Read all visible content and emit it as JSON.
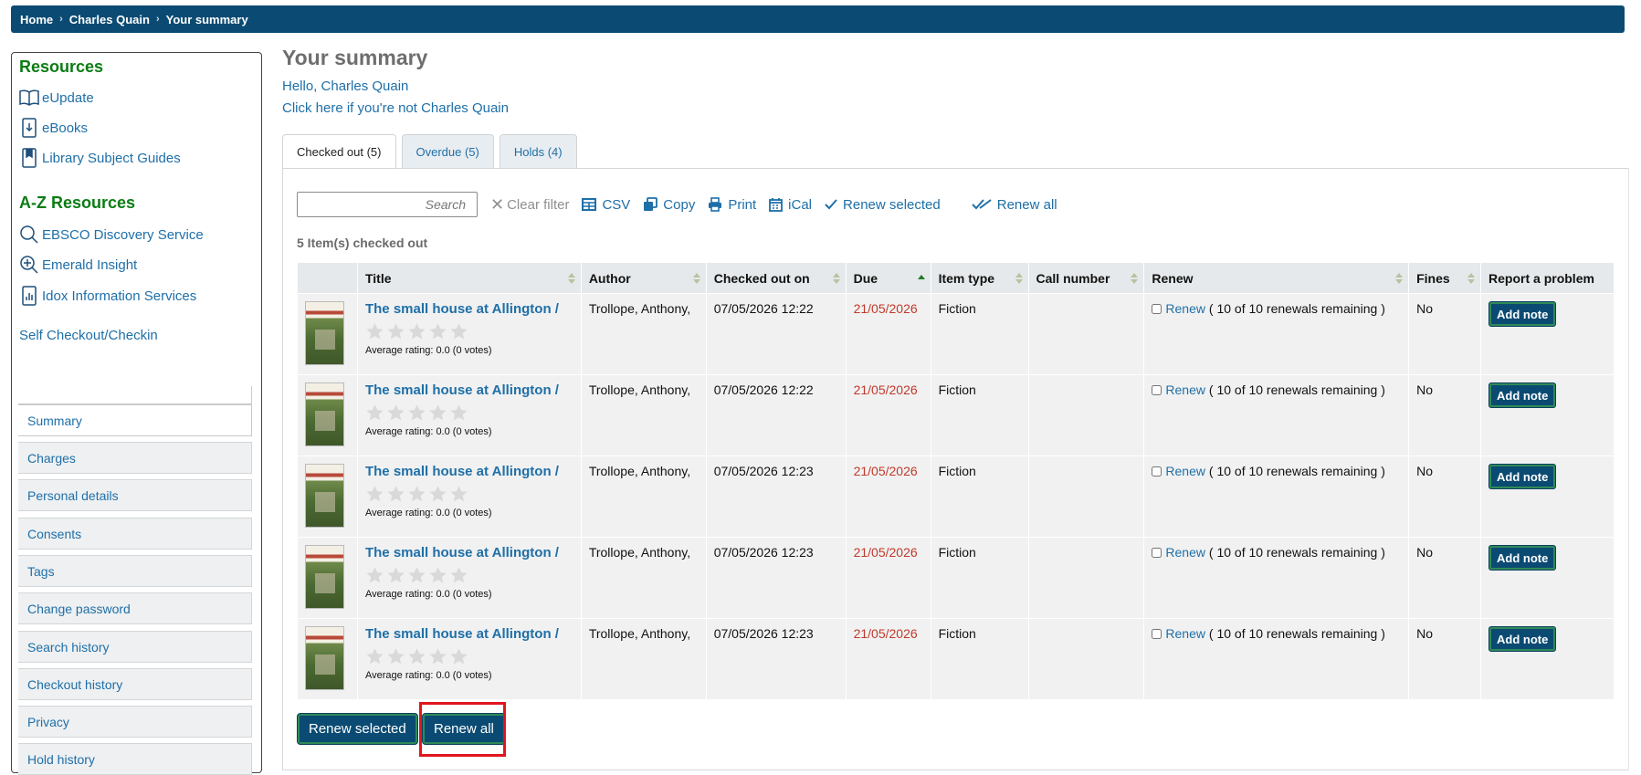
{
  "breadcrumb": [
    "Home",
    "Charles Quain",
    "Your summary"
  ],
  "sidebar": {
    "resources_heading": "Resources",
    "resources": [
      {
        "label": "eUpdate",
        "icon": "book-open-icon"
      },
      {
        "label": "eBooks",
        "icon": "download-file-icon"
      },
      {
        "label": "Library Subject Guides",
        "icon": "bookmark-icon"
      }
    ],
    "az_heading": "A-Z Resources",
    "az_resources": [
      {
        "label": "EBSCO Discovery Service",
        "icon": "search-icon"
      },
      {
        "label": "Emerald Insight",
        "icon": "zoom-in-icon"
      },
      {
        "label": "Idox Information Services",
        "icon": "bar-chart-icon"
      }
    ],
    "self_checkout": "Self Checkout/Checkin",
    "nav": [
      "Summary",
      "Charges",
      "Personal details",
      "Consents",
      "Tags",
      "Change password",
      "Search history",
      "Checkout history",
      "Privacy",
      "Hold history"
    ],
    "active_nav": "Summary"
  },
  "main": {
    "title": "Your summary",
    "hello": "Hello, Charles Quain",
    "not_me": "Click here if you're not Charles Quain",
    "tabs": [
      "Checked out (5)",
      "Overdue (5)",
      "Holds (4)"
    ],
    "active_tab": "Checked out (5)"
  },
  "toolbar": {
    "search_placeholder": "Search",
    "clear_filter": "Clear filter",
    "csv": "CSV",
    "copy": "Copy",
    "print": "Print",
    "ical": "iCal",
    "renew_selected": "Renew selected",
    "renew_all": "Renew all"
  },
  "count_label": "5 Item(s) checked out",
  "table": {
    "headers": [
      "",
      "Title",
      "Author",
      "Checked out on",
      "Due",
      "Item type",
      "Call number",
      "Renew",
      "Fines",
      "Report a problem"
    ],
    "rows": [
      {
        "title": "The small house at Allington /",
        "rating": "Average rating: 0.0 (0 votes)",
        "author": "Trollope, Anthony,",
        "checked_out": "07/05/2026 12:22",
        "due": "21/05/2026",
        "item_type": "Fiction",
        "call_number": "",
        "renew_link": "Renew",
        "renew_note": "( 10 of 10 renewals remaining )",
        "fines": "No",
        "action": "Add note"
      },
      {
        "title": "The small house at Allington /",
        "rating": "Average rating: 0.0 (0 votes)",
        "author": "Trollope, Anthony,",
        "checked_out": "07/05/2026 12:22",
        "due": "21/05/2026",
        "item_type": "Fiction",
        "call_number": "",
        "renew_link": "Renew",
        "renew_note": "( 10 of 10 renewals remaining )",
        "fines": "No",
        "action": "Add note"
      },
      {
        "title": "The small house at Allington /",
        "rating": "Average rating: 0.0 (0 votes)",
        "author": "Trollope, Anthony,",
        "checked_out": "07/05/2026 12:23",
        "due": "21/05/2026",
        "item_type": "Fiction",
        "call_number": "",
        "renew_link": "Renew",
        "renew_note": "( 10 of 10 renewals remaining )",
        "fines": "No",
        "action": "Add note"
      },
      {
        "title": "The small house at Allington /",
        "rating": "Average rating: 0.0 (0 votes)",
        "author": "Trollope, Anthony,",
        "checked_out": "07/05/2026 12:23",
        "due": "21/05/2026",
        "item_type": "Fiction",
        "call_number": "",
        "renew_link": "Renew",
        "renew_note": "( 10 of 10 renewals remaining )",
        "fines": "No",
        "action": "Add note"
      },
      {
        "title": "The small house at Allington /",
        "rating": "Average rating: 0.0 (0 votes)",
        "author": "Trollope, Anthony,",
        "checked_out": "07/05/2026 12:23",
        "due": "21/05/2026",
        "item_type": "Fiction",
        "call_number": "",
        "renew_link": "Renew",
        "renew_note": "( 10 of 10 renewals remaining )",
        "fines": "No",
        "action": "Add note"
      }
    ]
  },
  "bottom_actions": {
    "renew_selected": "Renew selected",
    "renew_all": "Renew all"
  },
  "colors": {
    "brand": "#0b4b73",
    "link": "#1e6fa8",
    "heading_green": "#0a7c14",
    "due_red": "#c0392b",
    "highlight": "#e0161e"
  }
}
